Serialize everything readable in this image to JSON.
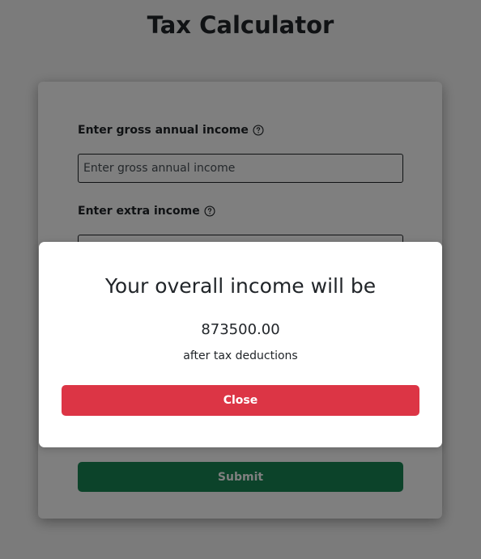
{
  "page": {
    "title": "Tax Calculator"
  },
  "form": {
    "gross_income": {
      "label": "Enter gross annual income",
      "placeholder": "Enter gross annual income",
      "value": ""
    },
    "extra_income": {
      "label": "Enter extra income",
      "placeholder": "",
      "value": ""
    },
    "submit_label": "Submit"
  },
  "modal": {
    "title": "Your overall income will be",
    "amount": "873500.00",
    "subtext": "after tax deductions",
    "close_label": "Close"
  },
  "icons": {
    "help": "help-circle-icon"
  },
  "colors": {
    "page_bg": "#f7f7f7",
    "submit_bg": "#198754",
    "close_bg": "#dc3545",
    "text": "#212529",
    "backdrop": "rgba(0,0,0,0.5)"
  }
}
